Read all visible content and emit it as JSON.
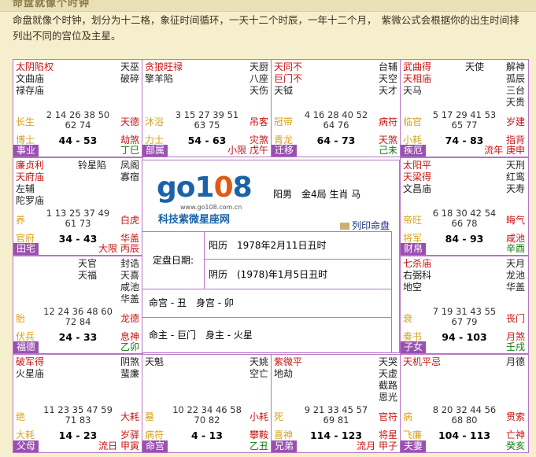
{
  "header": {
    "title": "命盘就像个时钟"
  },
  "intro": "命盘就像个时钟，划分为十二格，象征时间循环，一天十二个时辰，一年十二个月，　紫微公式会根据你的出生时间排列出不同的宫位及主星。",
  "center": {
    "logo": {
      "brand_a": "go1",
      "brand_zero": "0",
      "brand_b": "8",
      "url": "www.go108.com.cn",
      "cn": "科技紫微星座网"
    },
    "info": "阳男　金4局 生肖 马",
    "print": "列印命盘",
    "date_label": "定盘日期:",
    "solar": "阳历　1978年2月11日丑时",
    "lunar": "阴历　(1978)年1月5日丑时",
    "minggong": "命宫 - 丑　身宫 - 卯",
    "mingzhu": "命主 - 巨门　身主 - 火星"
  },
  "cells": [
    {
      "id": "si",
      "stars": [
        [
          "太阴陷权",
          "red"
        ],
        [
          "文曲庙",
          "blk"
        ],
        [
          "禄存庙",
          "blk"
        ]
      ],
      "mid": [],
      "right": [
        [
          "天巫",
          "blk"
        ],
        [
          "破碎",
          "blk"
        ]
      ],
      "nums": "2 14 26 38 50\n62 74",
      "lstage": "长生",
      "rstage": "天德",
      "lgod": "博士",
      "age": "44 - 53",
      "rgod": "劫煞",
      "palace": "事业",
      "bottom": "丁巳",
      "bottom_color": "grn"
    },
    {
      "id": "wu",
      "stars": [
        [
          "贪狼旺禄",
          "red"
        ],
        [
          "擎羊陷",
          "blk"
        ]
      ],
      "mid": [],
      "right": [
        [
          "天厨",
          "blk"
        ],
        [
          "八座",
          "blk"
        ],
        [
          "天伤",
          "blk"
        ]
      ],
      "nums": "3 15 27 39 51\n63 75",
      "lstage": "沐浴",
      "rstage": "吊客",
      "lgod": "力士",
      "age": "54 - 63",
      "rgod": "灾煞",
      "palace": "部属",
      "bottom": "小限 戊午",
      "bottom_color": "red"
    },
    {
      "id": "wei",
      "stars": [
        [
          "天同不",
          "red"
        ],
        [
          "巨门不",
          "red"
        ],
        [
          "天钺",
          "blk"
        ]
      ],
      "mid": [],
      "right": [
        [
          "台辅",
          "blk"
        ],
        [
          "天空",
          "blk"
        ],
        [
          "天才",
          "blk"
        ]
      ],
      "nums": "4 16 28 40 52\n64 76",
      "lstage": "冠带",
      "rstage": "病符",
      "lgod": "青龙",
      "age": "64 - 73",
      "rgod": "天煞",
      "palace": "迁移",
      "bottom": "己未",
      "bottom_color": "grn"
    },
    {
      "id": "shen",
      "stars": [
        [
          "武曲得",
          "red"
        ],
        [
          "天相庙",
          "red"
        ],
        [
          "天马",
          "blk"
        ]
      ],
      "mid": [
        [
          "天使",
          "blk"
        ]
      ],
      "right": [
        [
          "解神",
          "blk"
        ],
        [
          "孤辰",
          "blk"
        ],
        [
          "三台",
          "blk"
        ],
        [
          "天贵",
          "blk"
        ]
      ],
      "nums": "5 17 29 41 53\n65 77",
      "lstage": "临官",
      "rstage": "岁建",
      "lgod": "小耗",
      "age": "74 - 83",
      "rgod": "指背",
      "palace": "疾厄",
      "bottom": "流年 庚申",
      "bottom_color": "red"
    },
    {
      "id": "chen",
      "stars": [
        [
          "廉贞利",
          "red"
        ],
        [
          "天府庙",
          "red"
        ],
        [
          "左辅",
          "blk"
        ],
        [
          "陀罗庙",
          "blk"
        ]
      ],
      "mid": [
        [
          "铃星陷",
          "blk"
        ]
      ],
      "right": [
        [
          "凤阁",
          "blk"
        ],
        [
          "寡宿",
          "blk"
        ]
      ],
      "nums": "1 13 25 37 49\n61 73",
      "lstage": "养",
      "rstage": "白虎",
      "lgod": "官府",
      "age": "34 - 43",
      "rgod": "华盖",
      "palace": "田宅",
      "bottom": "大限 丙辰",
      "bottom_color": "red"
    },
    {
      "id": "you",
      "stars": [
        [
          "太阳平",
          "red"
        ],
        [
          "天梁得",
          "red"
        ],
        [
          "文昌庙",
          "blk"
        ]
      ],
      "mid": [],
      "right": [
        [
          "天刑",
          "blk"
        ],
        [
          "红鸾",
          "blk"
        ],
        [
          "天寿",
          "blk"
        ]
      ],
      "nums": "6 18 30 42 54\n66 78",
      "lstage": "帝旺",
      "rstage": "晦气",
      "lgod": "将军",
      "age": "84 - 93",
      "rgod": "咸池",
      "palace": "财帛",
      "bottom": "辛酉",
      "bottom_color": "grn"
    },
    {
      "id": "mao",
      "stars": [],
      "mid": [
        [
          "天官",
          "blk"
        ],
        [
          "天福",
          "blk"
        ]
      ],
      "right": [
        [
          "封诰",
          "blk"
        ],
        [
          "天喜",
          "blk"
        ],
        [
          "咸池",
          "blk"
        ],
        [
          "华盖",
          "blk"
        ]
      ],
      "nums": "12 24 36 48 60\n72 84",
      "lstage": "胎",
      "rstage": "龙德",
      "lgod": "伏兵",
      "age": "24 - 33",
      "rgod": "息神",
      "palace": "福德",
      "bottom": "乙卯",
      "bottom_color": "grn"
    },
    {
      "id": "xu",
      "stars": [
        [
          "七杀庙",
          "red"
        ],
        [
          "右弼科",
          "blk"
        ],
        [
          "地空",
          "blk"
        ]
      ],
      "mid": [],
      "right": [
        [
          "天月",
          "blk"
        ],
        [
          "龙池",
          "blk"
        ],
        [
          "华盖",
          "blk"
        ]
      ],
      "nums": "7 19 31 43 55\n67 79",
      "lstage": "衰",
      "rstage": "丧门",
      "lgod": "奏书",
      "age": "94 - 103",
      "rgod": "月煞",
      "palace": "子女",
      "bottom": "壬戌",
      "bottom_color": "grn"
    },
    {
      "id": "yin",
      "stars": [
        [
          "破军得",
          "red"
        ],
        [
          "火星庙",
          "blk"
        ]
      ],
      "mid": [],
      "right": [
        [
          "阴煞",
          "blk"
        ],
        [
          "蜚廉",
          "blk"
        ]
      ],
      "nums": "11 23 35 47 59\n71 83",
      "lstage": "绝",
      "rstage": "大耗",
      "lgod": "大耗",
      "age": "14 - 23",
      "rgod": "岁驿",
      "palace": "父母",
      "bottom": "流日 甲寅",
      "bottom_color": "red"
    },
    {
      "id": "chou",
      "stars": [
        [
          "天魁",
          "blk"
        ]
      ],
      "mid": [],
      "right": [
        [
          "天姚",
          "blk"
        ],
        [
          "空亡",
          "blk"
        ]
      ],
      "nums": "10 22 34 46 58\n70 82",
      "lstage": "墓",
      "rstage": "小耗",
      "lgod": "病符",
      "age": "4 - 13",
      "rgod": "攀鞍",
      "palace": "命宫",
      "bottom": "乙丑",
      "bottom_color": "grn"
    },
    {
      "id": "zi",
      "stars": [
        [
          "紫微平",
          "red"
        ],
        [
          "地劫",
          "blk"
        ]
      ],
      "mid": [],
      "right": [
        [
          "天哭",
          "blk"
        ],
        [
          "天虚",
          "blk"
        ],
        [
          "截路",
          "blk"
        ],
        [
          "恩光",
          "blk"
        ]
      ],
      "nums": "9 21 33 45 57\n69 81",
      "lstage": "死",
      "rstage": "官符",
      "lgod": "喜神",
      "age": "114 - 123",
      "rgod": "将星",
      "palace": "兄弟",
      "bottom": "流月 甲子",
      "bottom_color": "red"
    },
    {
      "id": "hai",
      "stars": [
        [
          "天机平忌",
          "red"
        ]
      ],
      "mid": [],
      "right": [
        [
          "月德",
          "blk"
        ]
      ],
      "nums": "8 20 32 44 56\n68 80",
      "lstage": "病",
      "rstage": "贯索",
      "lgod": "飞廉",
      "age": "104 - 113",
      "rgod": "亡神",
      "palace": "夫妻",
      "bottom": "癸亥",
      "bottom_color": "grn"
    }
  ]
}
